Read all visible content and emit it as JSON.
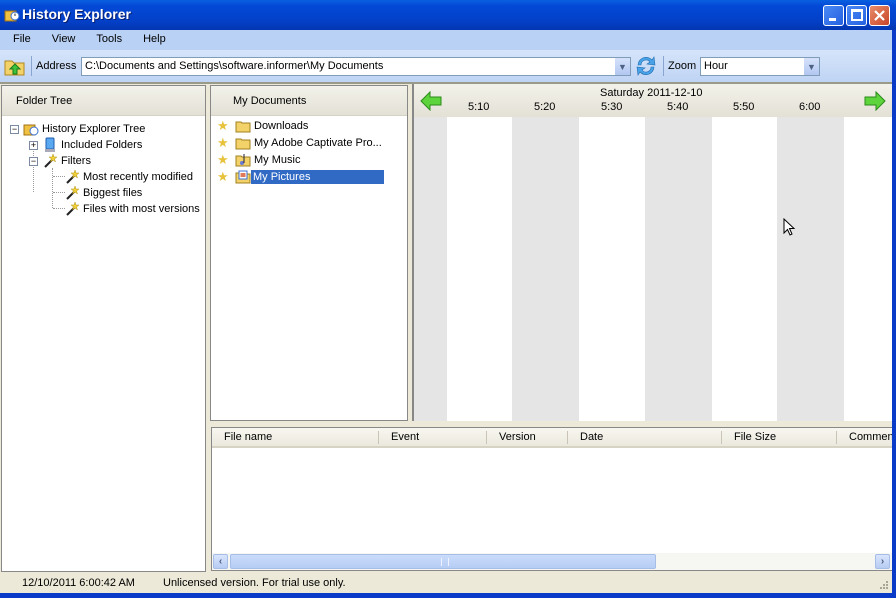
{
  "window": {
    "title": "History Explorer",
    "controls": [
      "minimize",
      "maximize",
      "close"
    ]
  },
  "menu": [
    "File",
    "View",
    "Tools",
    "Help"
  ],
  "toolbar": {
    "address_label": "Address",
    "address_value": "C:\\Documents and Settings\\software.informer\\My Documents",
    "zoom_label": "Zoom",
    "zoom_value": "Hour"
  },
  "folder_tree": {
    "header": "Folder Tree",
    "root": "History Explorer Tree",
    "items": [
      {
        "label": "Included Folders",
        "expanded": false
      },
      {
        "label": "Filters",
        "expanded": true
      }
    ],
    "filters": [
      "Most recently modified",
      "Biggest files",
      "Files with most versions"
    ]
  },
  "folder_list": {
    "header": "My Documents",
    "items": [
      {
        "label": "Downloads",
        "selected": false
      },
      {
        "label": "My Adobe Captivate Pro...",
        "selected": false
      },
      {
        "label": "My Music",
        "selected": false
      },
      {
        "label": "My Pictures",
        "selected": true
      }
    ]
  },
  "timeline": {
    "date": "Saturday 2011-12-10",
    "ticks": [
      "5:10",
      "5:20",
      "5:30",
      "5:40",
      "5:50",
      "6:00"
    ]
  },
  "files_table": {
    "columns": [
      "File name",
      "Event",
      "Version",
      "Date",
      "File Size",
      "Commen"
    ],
    "rows": []
  },
  "status": {
    "time": "12/10/2011 6:00:42 AM",
    "message": "Unlicensed version. For trial use only."
  },
  "colors": {
    "titlebar": "#0349d6",
    "selection": "#316ac5",
    "timeline_band": "#e5e5e5"
  }
}
